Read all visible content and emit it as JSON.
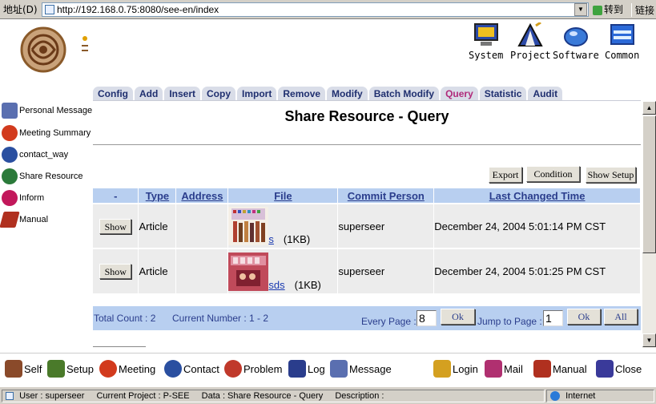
{
  "browser": {
    "address_label": "地址(D)",
    "url": "http://192.168.0.75:8080/see-en/index",
    "go_label": "转到",
    "links_label": "链接"
  },
  "top_icons": [
    {
      "label": "System",
      "icon": "system-monitor-icon"
    },
    {
      "label": "Project",
      "icon": "project-tent-icon"
    },
    {
      "label": "Software",
      "icon": "software-mouse-icon"
    },
    {
      "label": "Common",
      "icon": "common-window-icon"
    }
  ],
  "tabs": [
    {
      "label": "Config"
    },
    {
      "label": "Add"
    },
    {
      "label": "Insert"
    },
    {
      "label": "Copy"
    },
    {
      "label": "Import"
    },
    {
      "label": "Remove"
    },
    {
      "label": "Modify"
    },
    {
      "label": "Batch Modify"
    },
    {
      "label": "Query",
      "active": true
    },
    {
      "label": "Statistic"
    },
    {
      "label": "Audit"
    }
  ],
  "left_menu": [
    {
      "label": "Personal Message",
      "color": "#5a6fb0"
    },
    {
      "label": "Meeting Summary",
      "color": "#d23a1d"
    },
    {
      "label": "contact_way",
      "color": "#2a4fa0"
    },
    {
      "label": "Share Resource",
      "color": "#2b7a3a"
    },
    {
      "label": "Inform",
      "color": "#c2185b"
    },
    {
      "label": "Manual",
      "color": "#b0301f"
    }
  ],
  "page_title": "Share Resource - Query",
  "toolbar": {
    "export": "Export",
    "condition": "Condition",
    "show_setup": "Show Setup"
  },
  "table": {
    "headers": [
      "-",
      "Type",
      "Address",
      "File",
      "Commit Person",
      "Last Changed Time"
    ],
    "rows": [
      {
        "action": "Show",
        "type": "Article",
        "address": "",
        "file_name": "s",
        "file_size": "(1KB)",
        "commit_person": "superseer",
        "time": "December 24, 2004 5:01:14 PM CST"
      },
      {
        "action": "Show",
        "type": "Article",
        "address": "",
        "file_name": "sds",
        "file_size": "(1KB)",
        "commit_person": "superseer",
        "time": "December 24, 2004 5:01:25 PM CST"
      }
    ]
  },
  "pager": {
    "total_count": "Total Count : 2",
    "current_number": "Current Number : 1 - 2",
    "every_page_label": "Every Page :",
    "every_page_value": "8",
    "ok1": "Ok",
    "jump_label": "Jump to Page :",
    "jump_value": "1",
    "ok2": "Ok",
    "all": "All"
  },
  "bottom_nav": [
    {
      "label": "Self",
      "color": "#8a4a2a"
    },
    {
      "label": "Setup",
      "color": "#4a7a2a"
    },
    {
      "label": "Meeting",
      "color": "#d23a1d"
    },
    {
      "label": "Contact",
      "color": "#2a4fa0"
    },
    {
      "label": "Problem",
      "color": "#c0392b"
    },
    {
      "label": "Log",
      "color": "#2a3d8c"
    },
    {
      "label": "Message",
      "color": "#5a6fb0"
    },
    {
      "label": "Login",
      "color": "#d4a020"
    },
    {
      "label": "Mail",
      "color": "#b03070"
    },
    {
      "label": "Manual",
      "color": "#b0301f"
    },
    {
      "label": "Close",
      "color": "#3a3a9a"
    }
  ],
  "status": {
    "user": "User : superseer",
    "project": "Current Project : P-SEE",
    "data": "Data : Share Resource - Query",
    "description": "Description :",
    "zone": "Internet"
  }
}
